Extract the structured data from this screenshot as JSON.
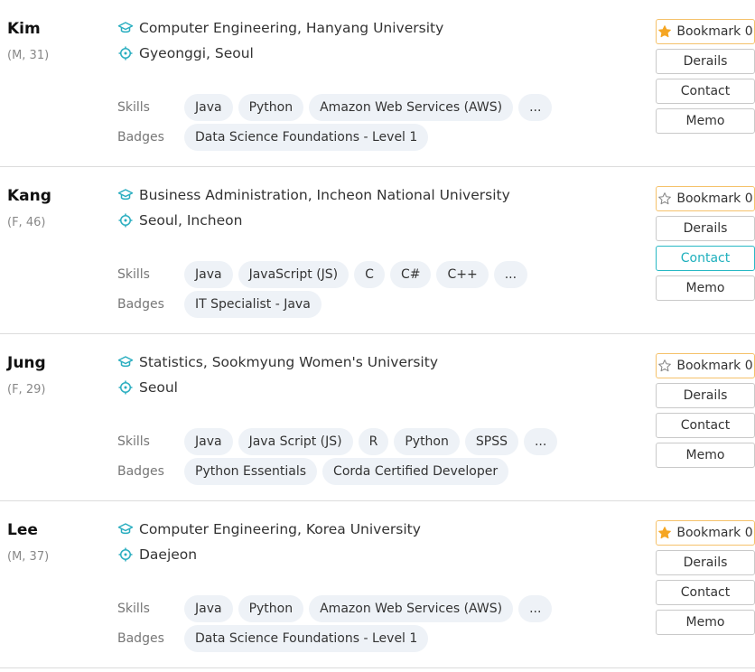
{
  "labels": {
    "skills": "Skills",
    "badges": "Badges"
  },
  "buttons": {
    "details": "Derails",
    "contact": "Contact",
    "memo": "Memo"
  },
  "colors": {
    "accent_teal": "#28b8c4",
    "star_gold": "#f5a623",
    "chip_bg": "#eef2f7"
  },
  "icons": {
    "education": "graduation-cap-icon",
    "location": "location-target-icon",
    "bookmark": "star-icon"
  },
  "candidates": [
    {
      "name": "Kim",
      "meta": "(M, 31)",
      "education": "Computer Engineering, Hanyang University",
      "location": "Gyeonggi, Seoul",
      "skills": [
        "Java",
        "Python",
        "Amazon Web Services (AWS)",
        "..."
      ],
      "badges": [
        "Data Science Foundations - Level 1"
      ],
      "bookmark_label": "Bookmark 0",
      "bookmarked": true,
      "contact_active": false
    },
    {
      "name": "Kang",
      "meta": "(F, 46)",
      "education": "Business Administration, Incheon National University",
      "location": "Seoul, Incheon",
      "skills": [
        "Java",
        "JavaScript (JS)",
        "C",
        "C#",
        "C++",
        "..."
      ],
      "badges": [
        "IT Specialist - Java"
      ],
      "bookmark_label": "Bookmark 0",
      "bookmarked": false,
      "contact_active": true
    },
    {
      "name": "Jung",
      "meta": "(F, 29)",
      "education": "Statistics, Sookmyung Women's University",
      "location": "Seoul",
      "skills": [
        "Java",
        "Java Script (JS)",
        "R",
        "Python",
        "SPSS",
        "..."
      ],
      "badges": [
        "Python Essentials",
        "Corda Certified Developer"
      ],
      "bookmark_label": "Bookmark 0",
      "bookmarked": false,
      "contact_active": false
    },
    {
      "name": "Lee",
      "meta": "(M, 37)",
      "education": "Computer Engineering, Korea University",
      "location": "Daejeon",
      "skills": [
        "Java",
        "Python",
        "Amazon Web Services (AWS)",
        "..."
      ],
      "badges": [
        "Data Science Foundations - Level 1"
      ],
      "bookmark_label": "Bookmark 0",
      "bookmarked": true,
      "contact_active": false
    }
  ]
}
